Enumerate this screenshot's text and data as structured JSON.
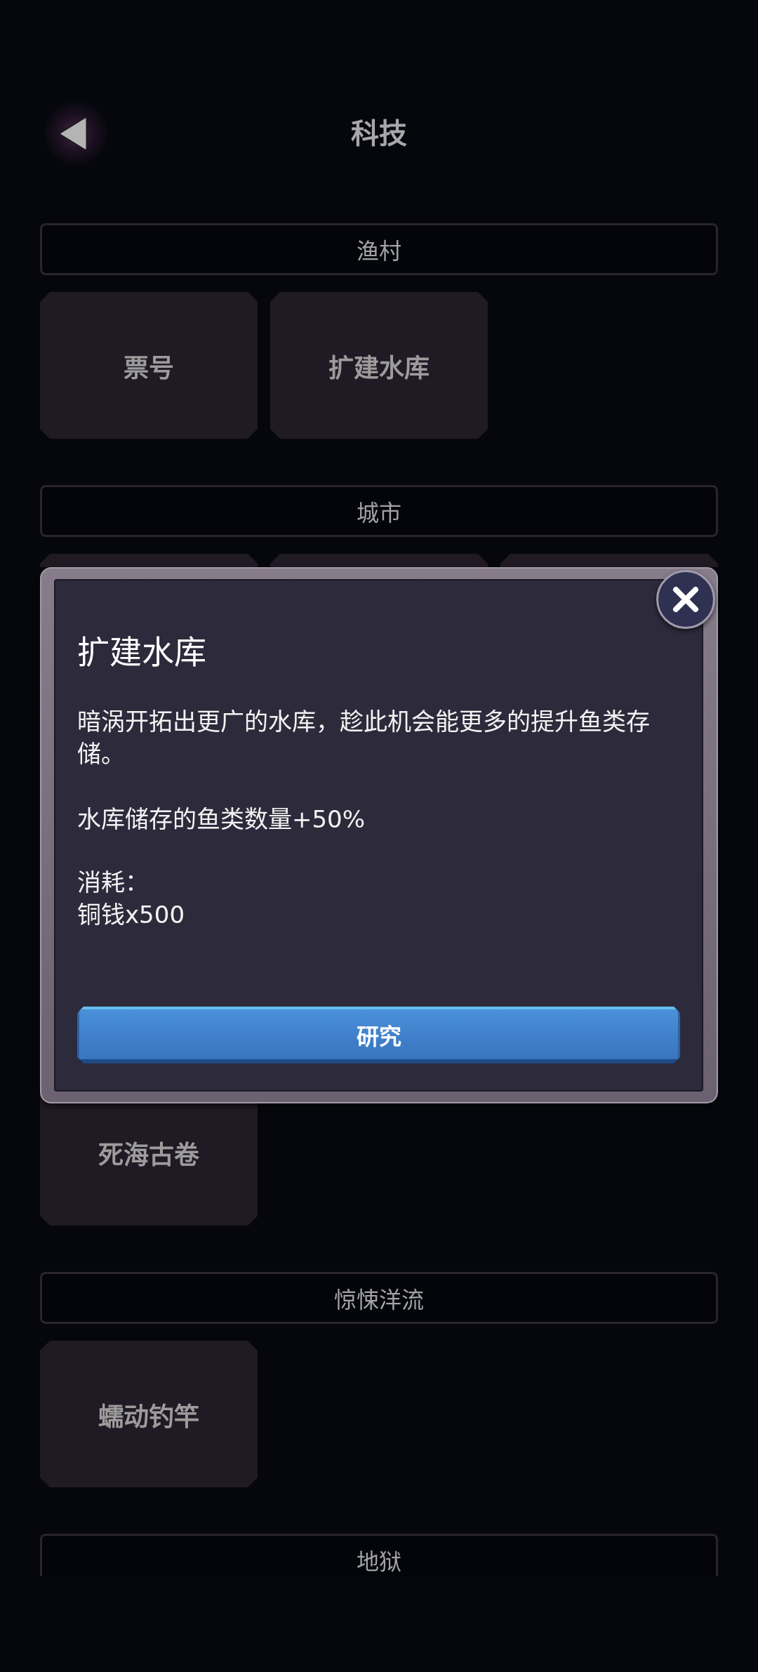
{
  "top_bar": {
    "title": "科技"
  },
  "sections": [
    {
      "title": "渔村",
      "tiles": [
        {
          "label": "票号",
          "covered": false
        },
        {
          "label": "扩建水库",
          "covered": false
        }
      ]
    },
    {
      "title": "城市",
      "tiles": [
        {
          "covered": true
        },
        {
          "covered": true
        },
        {
          "covered": true
        },
        {
          "label": "死海古卷",
          "covered": false
        }
      ]
    },
    {
      "title": "惊悚洋流",
      "tiles": [
        {
          "label": "蠕动钓竿",
          "covered": false
        }
      ]
    },
    {
      "title": "地狱"
    }
  ],
  "dialog": {
    "title": "扩建水库",
    "description": "暗涡开拓出更广的水库，趁此机会能更多的提升鱼类存储。",
    "effect": "水库储存的鱼类数量+50%",
    "cost_label": "消耗：",
    "cost": "铜钱x500",
    "button": "研究"
  }
}
